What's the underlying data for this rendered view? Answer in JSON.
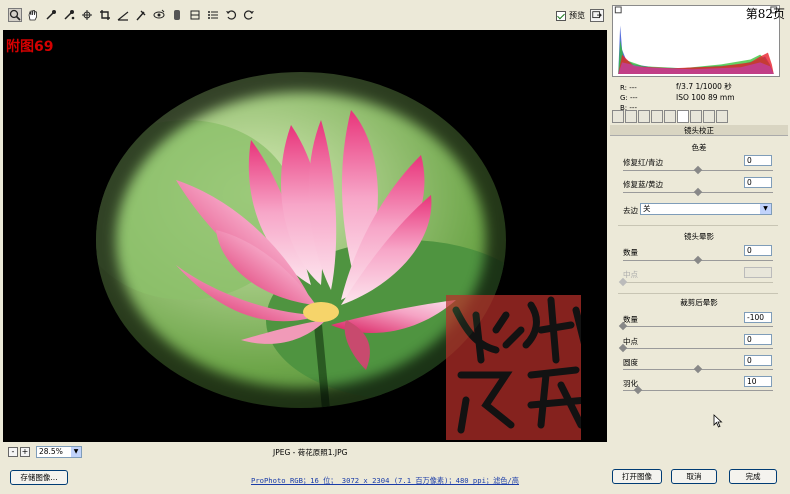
{
  "toolbar": {
    "tools": [
      {
        "name": "zoom-tool-icon",
        "active": true
      },
      {
        "name": "hand-tool-icon"
      },
      {
        "name": "white-balance-tool-icon"
      },
      {
        "name": "color-sampler-tool-icon"
      },
      {
        "name": "targeted-adjustment-tool-icon"
      },
      {
        "name": "crop-tool-icon"
      },
      {
        "name": "straighten-tool-icon"
      },
      {
        "name": "spot-removal-tool-icon"
      },
      {
        "name": "red-eye-tool-icon"
      },
      {
        "name": "adjustment-brush-tool-icon"
      },
      {
        "name": "graduated-filter-tool-icon"
      },
      {
        "name": "preferences-icon"
      },
      {
        "name": "rotate-left-icon"
      },
      {
        "name": "rotate-right-icon"
      }
    ],
    "preview_label": "预览",
    "preview_checked": true
  },
  "overlay_label": "附图69",
  "canvas": {
    "zoom_value": "28.5%",
    "zoom_minus": "-",
    "zoom_plus": "+",
    "filename": "JPEG - 荷花原照1.JPG"
  },
  "histogram": {
    "page_number": "第82页"
  },
  "readout": {
    "r": "R:  ---",
    "g": "G:  ---",
    "b": "B:  ---",
    "exif_line1": "f/3.7   1/1000 秒",
    "exif_line2": "ISO 100   89 mm"
  },
  "panel": {
    "title": "镜头校正",
    "chromatic": {
      "heading": "色差",
      "red_cyan_label": "修复红/青边",
      "red_cyan_value": "0",
      "red_cyan_fraction": 0.5,
      "blue_yellow_label": "修复蓝/黄边",
      "blue_yellow_value": "0",
      "blue_yellow_fraction": 0.5,
      "defringe_label": "去边",
      "defringe_value": "关"
    },
    "lens_vignette": {
      "heading": "镜头晕影",
      "amount_label": "数量",
      "amount_value": "0",
      "amount_fraction": 0.5,
      "midpoint_label": "中点",
      "midpoint_value": ""
    },
    "post_crop": {
      "heading": "裁剪后晕影",
      "amount_label": "数量",
      "amount_value": "-100",
      "amount_fraction": 0.0,
      "midpoint_label": "中点",
      "midpoint_value": "0",
      "midpoint_fraction": 0.0,
      "roundness_label": "圆度",
      "roundness_value": "0",
      "roundness_fraction": 0.5,
      "feather_label": "羽化",
      "feather_value": "10",
      "feather_fraction": 0.1
    }
  },
  "bottom": {
    "save_label": "存储图像...",
    "workflow_text": "ProPhoto RGB；16 位； 3072 x 2304 (7.1 百万像素)；480 ppi；滤色/高",
    "open_label": "打开图像",
    "cancel_label": "取消",
    "done_label": "完成"
  },
  "colors": {
    "chrome": "#ece9d8",
    "canvas": "#000000",
    "label_red": "#d40000",
    "link_blue": "#1a3ca8",
    "seal_red": "#b9302a"
  }
}
